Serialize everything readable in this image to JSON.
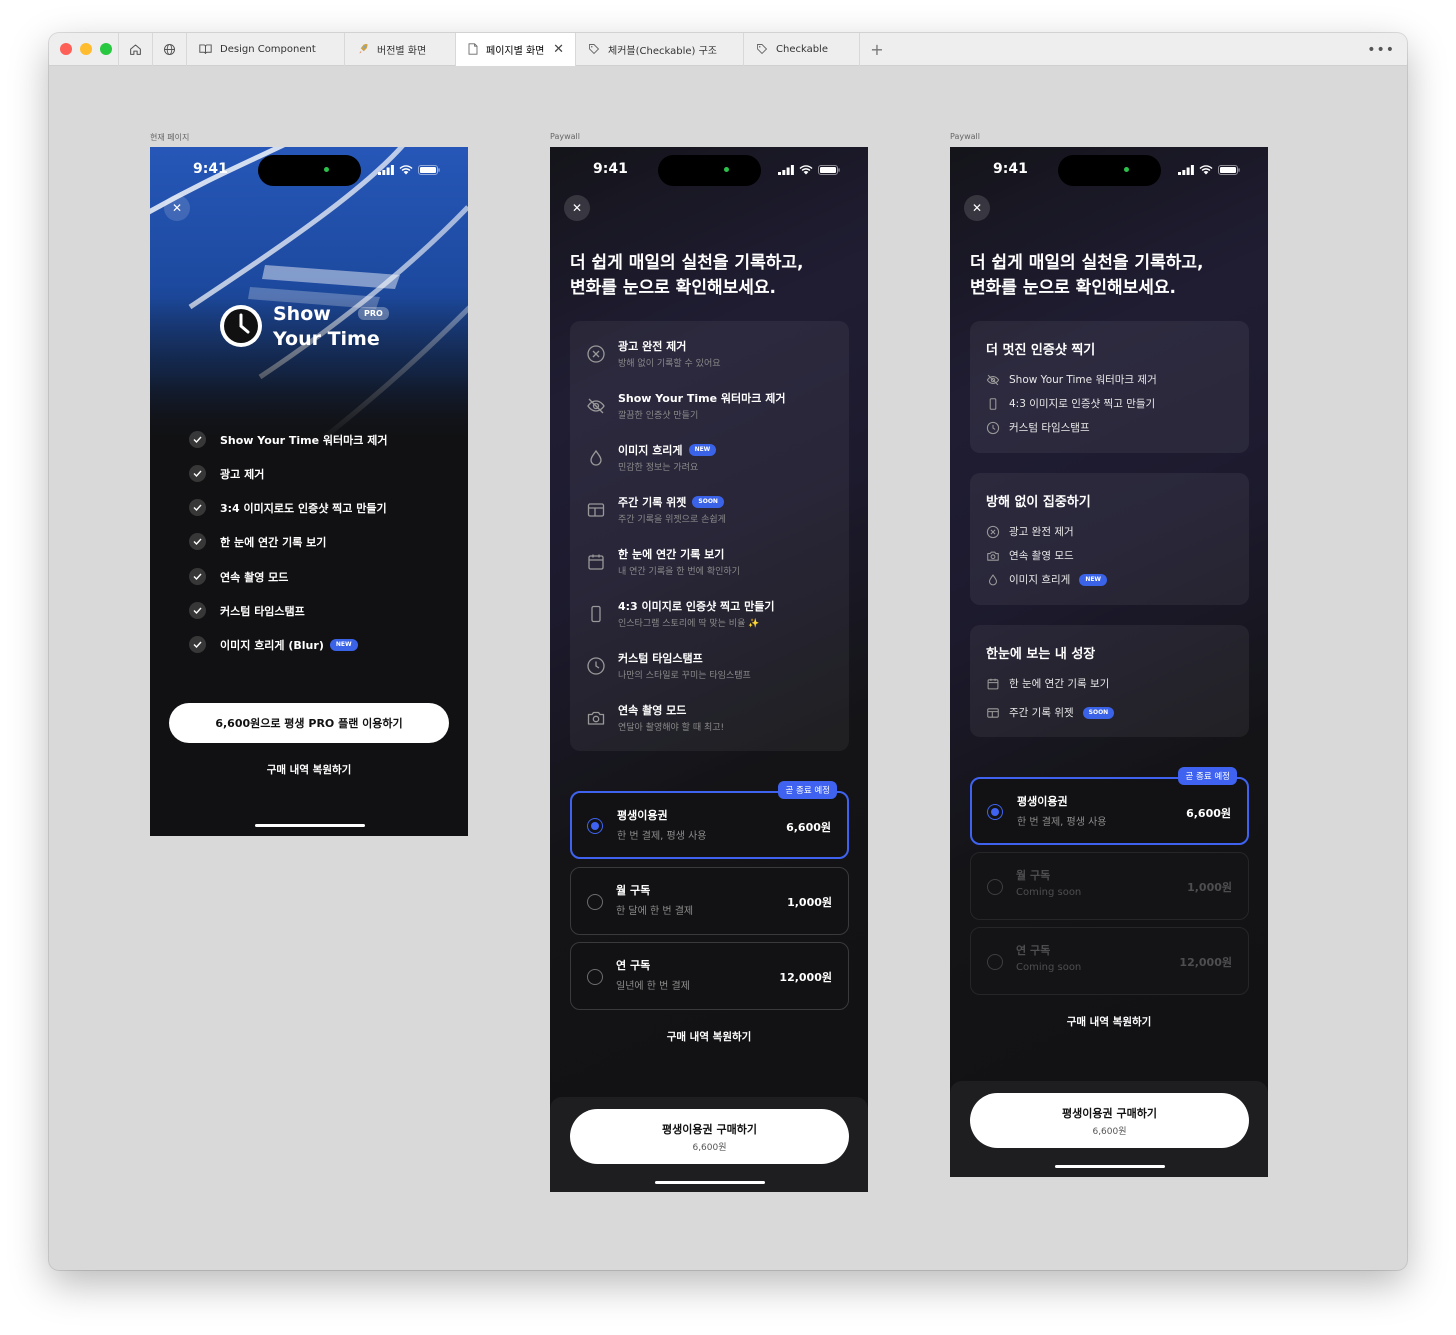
{
  "tabs": [
    {
      "label": "Design Component",
      "icon": "book-icon"
    },
    {
      "label": "버전별 화면",
      "icon": "rocket-icon"
    },
    {
      "label": "페이지별 화면",
      "icon": "page-icon",
      "active": true
    },
    {
      "label": "체커블(Checkable) 구조",
      "icon": "tag-icon"
    },
    {
      "label": "Checkable",
      "icon": "tag-icon"
    }
  ],
  "frame_labels": [
    "현재 페이지",
    "Paywall",
    "Paywall"
  ],
  "status_time": "9:41",
  "phone1": {
    "logo_line1": "Show",
    "logo_line2": "Your Time",
    "logo_badge": "PRO",
    "features": [
      "Show Your Time 워터마크 제거",
      "광고 제거",
      "3:4 이미지로도 인증샷 찍고 만들기",
      "한 눈에 연간 기록 보기",
      "연속 촬영 모드",
      "커스텀 타임스탬프",
      "이미지 흐리게 (Blur)"
    ],
    "feature_badge": "NEW",
    "cta": "6,600원으로 평생 PRO 플랜 이용하기",
    "restore": "구매 내역 복원하기"
  },
  "headline_line1": "더 쉽게 매일의 실천을 기록하고,",
  "headline_line2": "변화를 눈으로 확인해보세요.",
  "phone2": {
    "features": [
      {
        "title": "광고 완전 제거",
        "sub": "방해 없이 기록할 수 있어요",
        "icon": "no-ads-icon"
      },
      {
        "title": "Show Your Time 워터마크 제거",
        "sub": "깔끔한 인증샷 만들기",
        "icon": "eye-off-icon"
      },
      {
        "title": "이미지 흐리게",
        "sub": "민감한 정보는 가려요",
        "badge": "NEW",
        "icon": "drop-icon"
      },
      {
        "title": "주간 기록 위젯",
        "sub": "주간 기록을 위젯으로 손쉽게",
        "badge": "SOON",
        "icon": "widget-icon"
      },
      {
        "title": "한 눈에 연간 기록 보기",
        "sub": "내 연간 기록을 한 번에 확인하기",
        "icon": "calendar-icon"
      },
      {
        "title": "4:3 이미지로 인증샷 찍고 만들기",
        "sub": "인스타그램 스토리에 딱 맞는 비율 ✨",
        "icon": "phone-icon"
      },
      {
        "title": "커스텀 타임스탬프",
        "sub": "나만의 스타일로 꾸미는 타임스탬프",
        "icon": "clock-icon"
      },
      {
        "title": "연속 촬영 모드",
        "sub": "연달아 촬영해야 할 때 최고!",
        "icon": "camera-icon"
      }
    ],
    "plans": [
      {
        "name": "평생이용권",
        "desc": "한 번 결제, 평생 사용",
        "price": "6,600원",
        "tag": "곧 종료 예정",
        "selected": true
      },
      {
        "name": "월 구독",
        "desc": "한 달에 한 번 결제",
        "price": "1,000원"
      },
      {
        "name": "연 구독",
        "desc": "일년에 한 번 결제",
        "price": "12,000원"
      }
    ],
    "restore": "구매 내역 복원하기",
    "cta_title": "평생이용권 구매하기",
    "cta_price": "6,600원"
  },
  "phone3": {
    "groups": [
      {
        "title": "더 멋진 인증샷 찍기",
        "items": [
          {
            "label": "Show Your Time 워터마크 제거",
            "icon": "eye-off-icon"
          },
          {
            "label": "4:3 이미지로 인증샷 찍고 만들기",
            "icon": "phone-icon"
          },
          {
            "label": "커스텀 타임스탬프",
            "icon": "clock-icon"
          }
        ]
      },
      {
        "title": "방해 없이 집중하기",
        "items": [
          {
            "label": "광고 완전 제거",
            "icon": "no-ads-icon"
          },
          {
            "label": "연속 촬영 모드",
            "icon": "camera-icon"
          },
          {
            "label": "이미지 흐리게",
            "icon": "drop-icon",
            "badge": "NEW"
          }
        ]
      },
      {
        "title": "한눈에 보는 내 성장",
        "items": [
          {
            "label": "한 눈에 연간 기록 보기",
            "icon": "calendar-icon"
          },
          {
            "label": "주간 기록 위젯",
            "icon": "widget-icon",
            "badge": "SOON"
          }
        ]
      }
    ],
    "plans": [
      {
        "name": "평생이용권",
        "desc": "한 번 결제, 평생 사용",
        "price": "6,600원",
        "tag": "곧 종료 예정",
        "selected": true
      },
      {
        "name": "월 구독",
        "desc": "Coming soon",
        "price": "1,000원",
        "disabled": true
      },
      {
        "name": "연 구독",
        "desc": "Coming soon",
        "price": "12,000원",
        "disabled": true
      }
    ],
    "restore": "구매 내역 복원하기",
    "cta_title": "평생이용권 구매하기",
    "cta_price": "6,600원"
  },
  "colors": {
    "accent": "#3f63f0",
    "canvas": "#d9d9d9",
    "phone_bg": "#111113"
  }
}
